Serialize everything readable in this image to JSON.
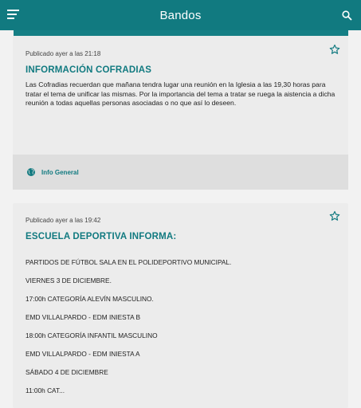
{
  "header": {
    "title": "Bandos"
  },
  "posts": [
    {
      "meta": "Publicado ayer a las 21:18",
      "title": "INFORMACIÓN COFRADIAS",
      "body": "Las Cofradias recuerdan que mañana tendra lugar una reunión en la Iglesia a las 19,30 horas para tratar el tema de unificar las mismas. Por la importancia del tema a tratar se ruega la aistencia a dicha reunión a todas aquellas personas asociadas o no que así lo deseen.",
      "category": "Info General"
    },
    {
      "meta": "Publicado ayer a las 19:42",
      "title": "ESCUELA DEPORTIVA INFORMA:",
      "lines": [
        "PARTIDOS DE FÚTBOL SALA EN EL POLIDEPORTIVO MUNICIPAL.",
        "VIERNES 3 DE DICIEMBRE.",
        "17:00h CATEGORÍA ALEVÍN MASCULINO.",
        "EMD VILLALPARDO - EDM INIESTA B",
        "18:00h CATEGORÍA INFANTIL MASCULINO",
        "EMD VILLALPARDO - EDM INIESTA A",
        "SÁBADO 4 DE DICIEMBRE",
        "11:00h CAT..."
      ]
    }
  ],
  "colors": {
    "primary": "#117a80",
    "card": "#ececec",
    "footer": "#dedede"
  }
}
